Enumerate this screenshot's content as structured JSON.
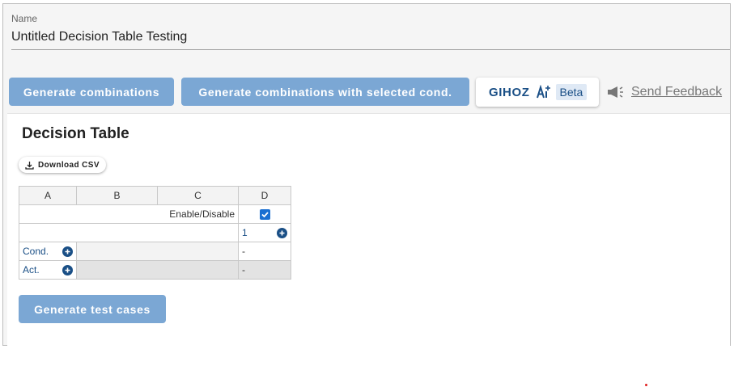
{
  "name_field": {
    "label": "Name",
    "value": "Untitled Decision Table Testing"
  },
  "toolbar": {
    "generate_label": "Generate combinations",
    "generate_selected_label": "Generate combinations with selected cond.",
    "gihoz_label": "GIHOZ",
    "beta_label": "Beta",
    "feedback_label": "Send Feedback",
    "button_color": "#7ba7d4"
  },
  "decision_table": {
    "title": "Decision Table",
    "download_label": "Download CSV",
    "columns": [
      "A",
      "B",
      "C",
      "D"
    ],
    "enable_label": "Enable/Disable",
    "enable_checked": true,
    "case_number": "1",
    "cond_label": "Cond.",
    "act_label": "Act.",
    "cond_value": "-",
    "act_value": "-"
  },
  "footer": {
    "generate_tests_label": "Generate test cases"
  },
  "colors": {
    "accent": "#1a4f86",
    "button": "#7ba7d4"
  }
}
